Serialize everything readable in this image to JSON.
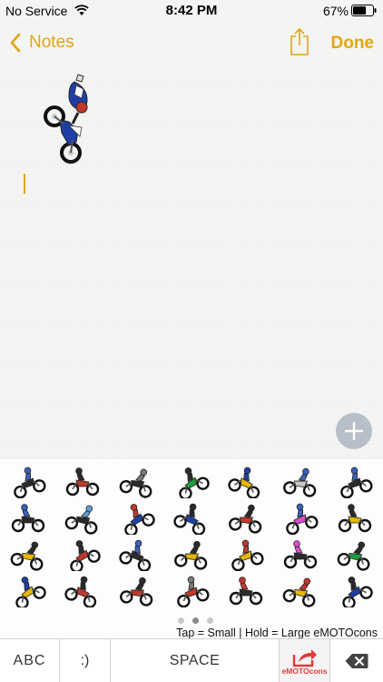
{
  "status_bar": {
    "carrier": "No Service",
    "time": "8:42 PM",
    "battery_percent": "67%",
    "battery_level": 0.67
  },
  "nav": {
    "back_label": "Notes",
    "done_label": "Done"
  },
  "colors": {
    "accent": "#e2a514",
    "add_button": "#b9bfc8",
    "emoto_red": "#e23a3a"
  },
  "keyboard": {
    "hint": "Tap = Small | Hold = Large eMOTOcons",
    "abc_label": "ABC",
    "emoji_label": ":)",
    "space_label": "SPACE",
    "emoto_label": "eMOTOcons",
    "page_count": 3,
    "active_page": 1,
    "stickers": [
      {
        "bike": "#2b2b2b",
        "rider": "#3a62b8"
      },
      {
        "bike": "#c0392b",
        "rider": "#2b2b2b"
      },
      {
        "bike": "#2b2b2b",
        "rider": "#7a7a7a"
      },
      {
        "bike": "#1e9e3a",
        "rider": "#2b2b2b"
      },
      {
        "bike": "#e6b800",
        "rider": "#1f3fa8"
      },
      {
        "bike": "#c7c7c7",
        "rider": "#3a62b8"
      },
      {
        "bike": "#2b2b2b",
        "rider": "#3a62b8"
      },
      {
        "bike": "#2b2b2b",
        "rider": "#3a62b8"
      },
      {
        "bike": "#2b2b2b",
        "rider": "#5aa0d8"
      },
      {
        "bike": "#1f3fa8",
        "rider": "#c0392b"
      },
      {
        "bike": "#1f3fa8",
        "rider": "#2b2b2b"
      },
      {
        "bike": "#c0392b",
        "rider": "#2b2b2b"
      },
      {
        "bike": "#d94fd0",
        "rider": "#3a62b8"
      },
      {
        "bike": "#e6b800",
        "rider": "#2b2b2b"
      },
      {
        "bike": "#e6b800",
        "rider": "#2b2b2b"
      },
      {
        "bike": "#c0392b",
        "rider": "#2b2b2b"
      },
      {
        "bike": "#2b2b2b",
        "rider": "#3a62b8"
      },
      {
        "bike": "#e6b800",
        "rider": "#2b2b2b"
      },
      {
        "bike": "#e6b800",
        "rider": "#c0392b"
      },
      {
        "bike": "#2b2b2b",
        "rider": "#d94fd0"
      },
      {
        "bike": "#1e9e3a",
        "rider": "#2b2b2b"
      },
      {
        "bike": "#e6b800",
        "rider": "#1f3fa8"
      },
      {
        "bike": "#c0392b",
        "rider": "#2b2b2b"
      },
      {
        "bike": "#c0392b",
        "rider": "#2b2b2b"
      },
      {
        "bike": "#c0392b",
        "rider": "#7a7a7a"
      },
      {
        "bike": "#2b2b2b",
        "rider": "#c0392b"
      },
      {
        "bike": "#e6b800",
        "rider": "#c0392b"
      },
      {
        "bike": "#1f3fa8",
        "rider": "#2b2b2b"
      }
    ]
  }
}
